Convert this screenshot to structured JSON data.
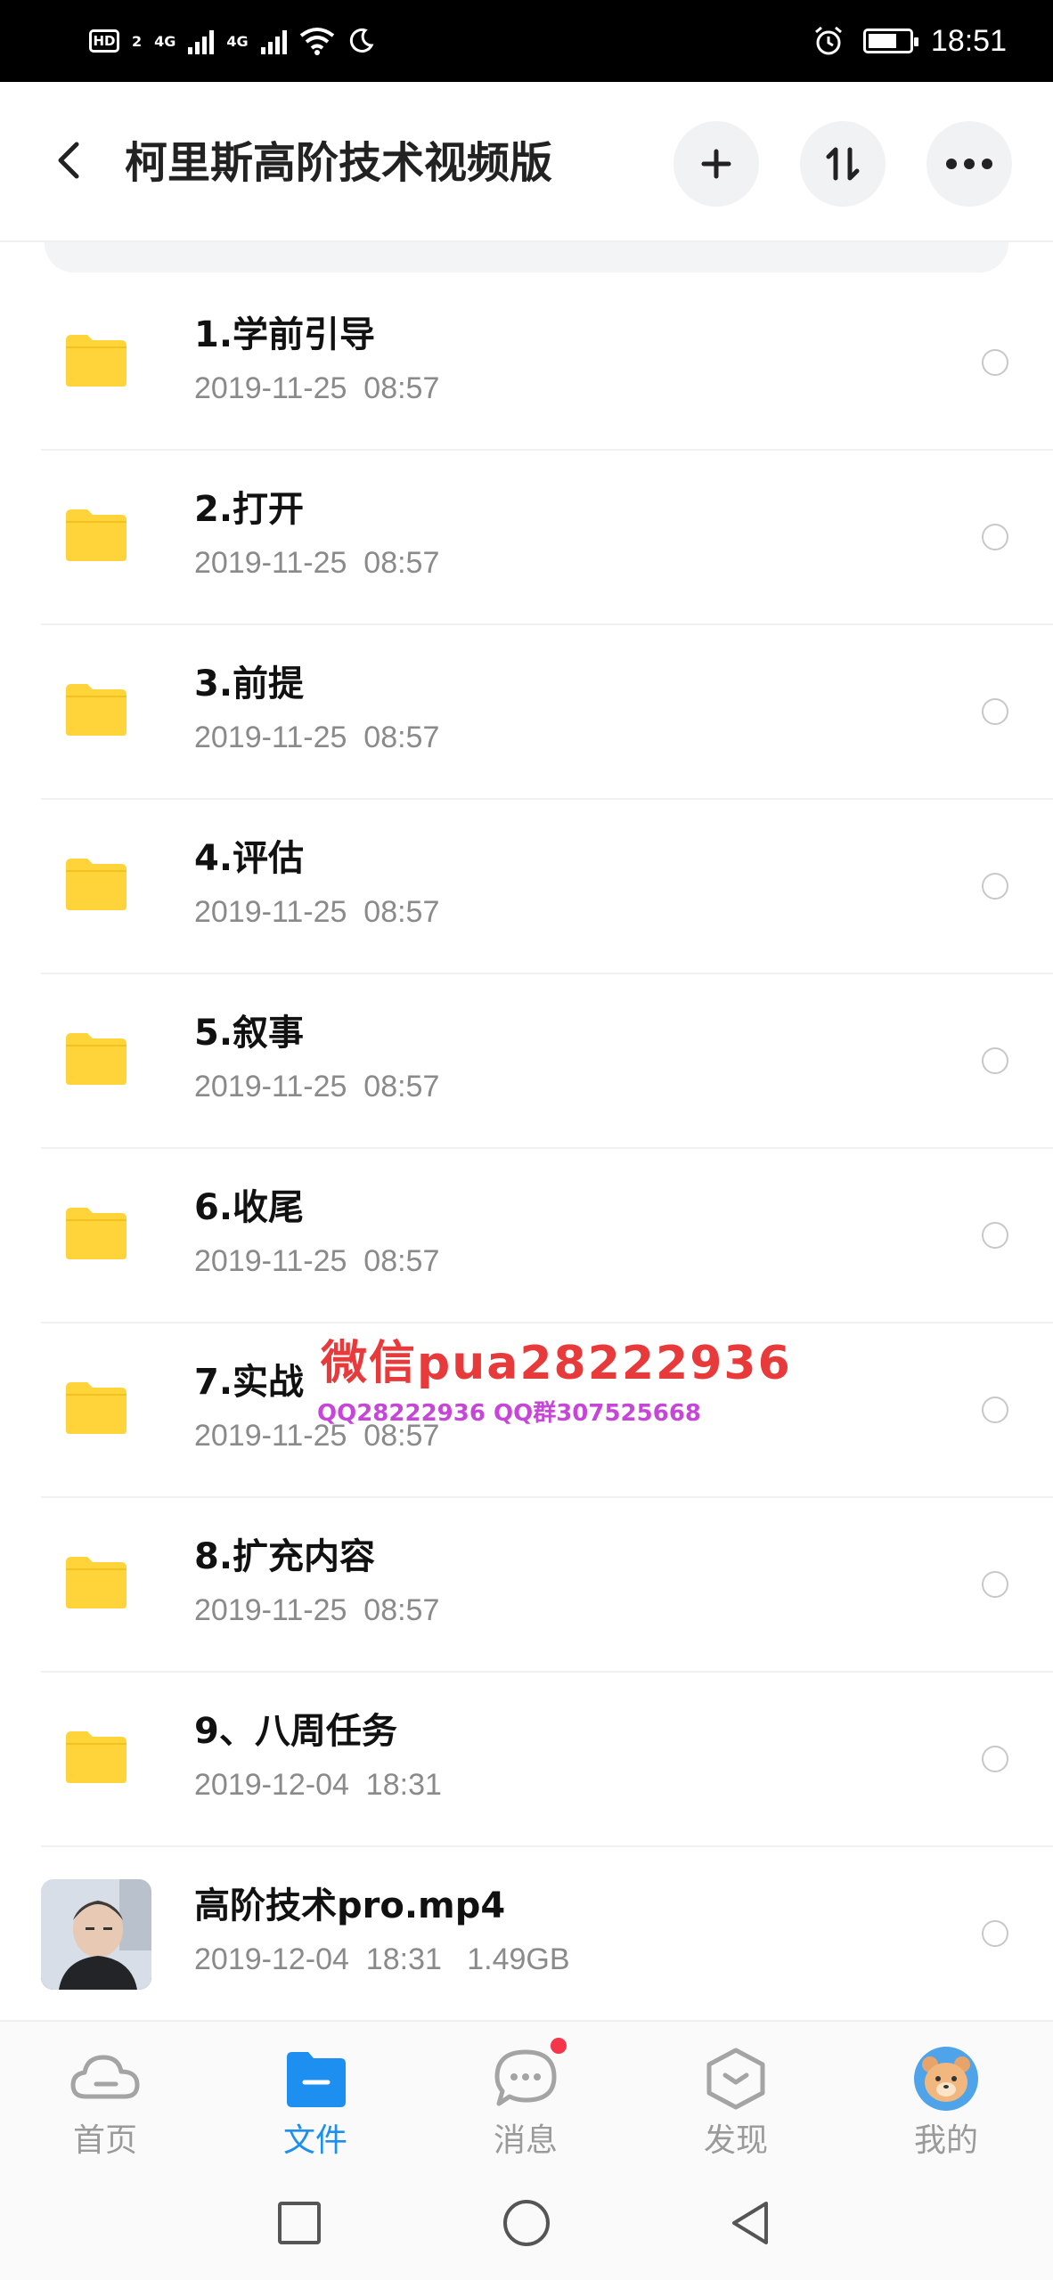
{
  "status_bar": {
    "hd_label": "HD",
    "sim_label": "2",
    "network_1": "4G",
    "network_2": "4G",
    "time": "18:51",
    "battery_level": 0.7
  },
  "header": {
    "title": "柯里斯高阶技术视频版"
  },
  "files": [
    {
      "name": "1.学前引导",
      "meta": "2019-11-25  08:57",
      "type": "folder"
    },
    {
      "name": "2.打开",
      "meta": "2019-11-25  08:57",
      "type": "folder"
    },
    {
      "name": "3.前提",
      "meta": "2019-11-25  08:57",
      "type": "folder"
    },
    {
      "name": "4.评估",
      "meta": "2019-11-25  08:57",
      "type": "folder"
    },
    {
      "name": "5.叙事",
      "meta": "2019-11-25  08:57",
      "type": "folder"
    },
    {
      "name": "6.收尾",
      "meta": "2019-11-25  08:57",
      "type": "folder"
    },
    {
      "name": "7.实战",
      "meta": "2019-11-25  08:57",
      "type": "folder"
    },
    {
      "name": "8.扩充内容",
      "meta": "2019-11-25  08:57",
      "type": "folder"
    },
    {
      "name": "9、八周任务",
      "meta": "2019-12-04  18:31",
      "type": "folder"
    },
    {
      "name": "高阶技术pro.mp4",
      "meta": "2019-12-04  18:31   1.49GB",
      "type": "video"
    }
  ],
  "watermark": {
    "main": "微信pua28222936",
    "sub": "QQ28222936 QQ群307525668"
  },
  "bottom_nav": {
    "items": [
      {
        "label": "首页",
        "icon": "cloud-icon"
      },
      {
        "label": "文件",
        "icon": "folder-icon",
        "active": true
      },
      {
        "label": "消息",
        "icon": "chat-icon",
        "badge": true
      },
      {
        "label": "发现",
        "icon": "discover-icon"
      },
      {
        "label": "我的",
        "icon": "avatar-icon"
      }
    ]
  },
  "colors": {
    "folder": "#ffd43b",
    "accent": "#1c8ff0",
    "badge": "#f4354a",
    "watermark_red": "#e83a3a",
    "watermark_purple": "#c646d8"
  }
}
